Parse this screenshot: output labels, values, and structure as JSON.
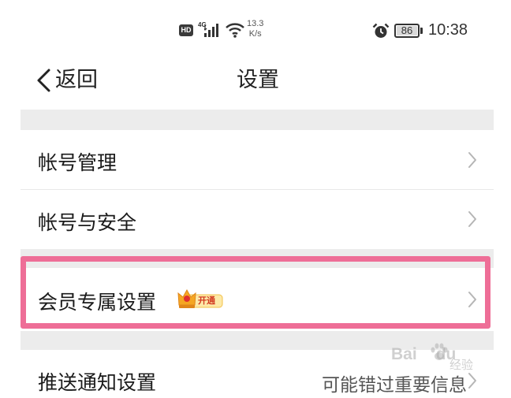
{
  "status_bar": {
    "hd": "HD",
    "network": "4G",
    "speed_value": "13.3",
    "speed_unit": "K/s",
    "battery": "86",
    "time": "10:38"
  },
  "title_bar": {
    "back_label": "返回",
    "title": "设置"
  },
  "settings": {
    "account_management": "帐号管理",
    "account_security": "帐号与安全",
    "vip_settings": "会员专属设置",
    "vip_badge": "开通",
    "push_notifications": "推送通知设置",
    "push_notifications_value": "可能错过重要信息"
  },
  "watermark": {
    "brand": "Bai",
    "brand2": "du",
    "sub": "经验"
  },
  "colors": {
    "highlight": "#ee6e97",
    "section_gap": "#ececec",
    "vip_gold": "#f5a623"
  }
}
